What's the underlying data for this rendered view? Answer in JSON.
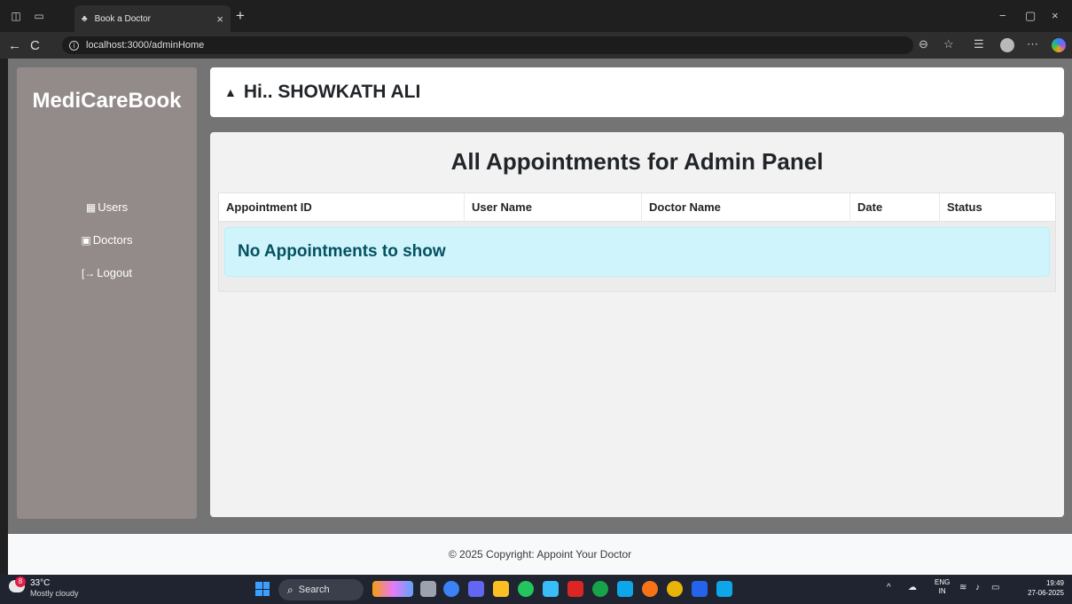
{
  "browser": {
    "tab_title": "Book a Doctor",
    "tab_close": "×",
    "new_tab": "+",
    "url": "localhost:3000/adminHome",
    "back_icon": "←",
    "refresh_icon": "C",
    "minimize_icon": "−",
    "maximize_icon": "▢",
    "close_icon": "×"
  },
  "sidebar": {
    "brand": "MediCareBook",
    "items": [
      {
        "label": "Users",
        "icon": "calendar-icon",
        "glyph": "▦"
      },
      {
        "label": "Doctors",
        "icon": "doctor-icon",
        "glyph": "▣"
      },
      {
        "label": "Logout",
        "icon": "logout-icon",
        "glyph": "[→"
      }
    ]
  },
  "header": {
    "bell_glyph": "🔔",
    "greeting": "Hi.. SHOWKATH ALI"
  },
  "main": {
    "title": "All Appointments for Admin Panel",
    "columns": [
      "Appointment ID",
      "User Name",
      "Doctor Name",
      "Date",
      "Status"
    ],
    "empty_message": "No Appointments to show"
  },
  "footer": {
    "text": "© 2025 Copyright: Appoint Your Doctor"
  },
  "taskbar": {
    "weather_badge": "8",
    "temperature": "33°C",
    "weather": "Mostly cloudy",
    "search_placeholder": "Search",
    "lang_line1": "ENG",
    "lang_line2": "IN",
    "time": "19:49",
    "date": "27-06-2025"
  },
  "colors": {
    "sidebar_bg": "#938a8a",
    "alert_bg": "#cff4fc",
    "alert_text": "#055160"
  }
}
